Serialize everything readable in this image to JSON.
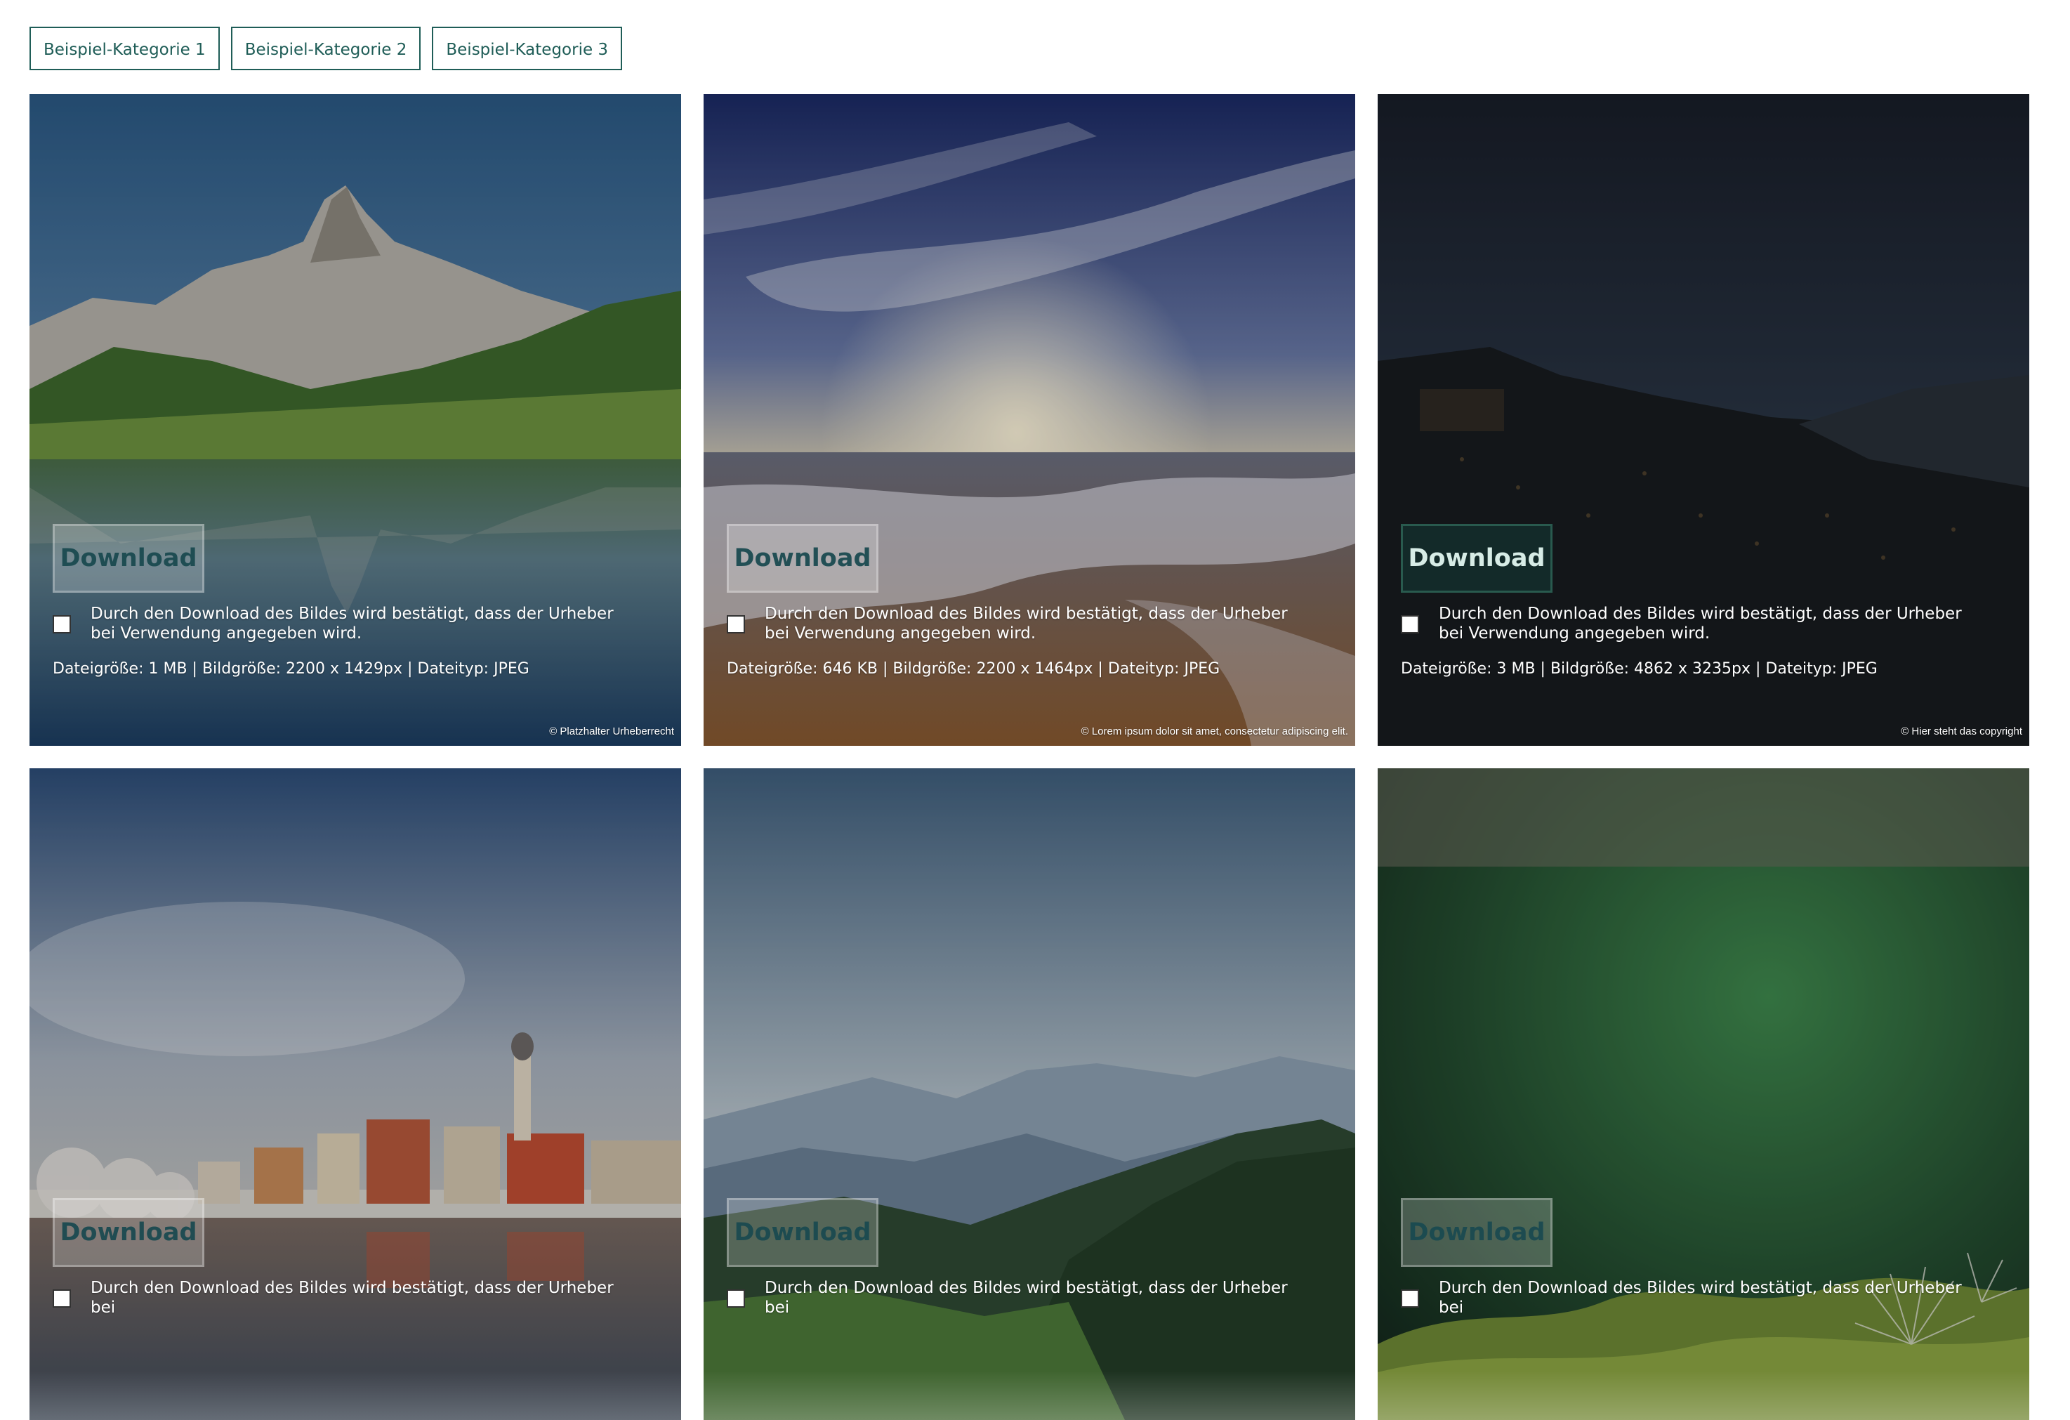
{
  "categories": [
    "Beispiel-Kategorie 1",
    "Beispiel-Kategorie 2",
    "Beispiel-Kategorie 3"
  ],
  "tiles": [
    {
      "scene": "mountain-lake",
      "download_label": "Download",
      "consent": "Durch den Download des Bildes wird bestätigt, dass der Urheber bei Verwendung angegeben wird.",
      "meta": "Dateigröße: 1 MB | Bildgröße: 2200 x 1429px | Dateityp: JPEG",
      "copyright": "© Platzhalter Urheberrecht"
    },
    {
      "scene": "beach-sunset",
      "download_label": "Download",
      "consent": "Durch den Download des Bildes wird bestätigt, dass der Urheber bei Verwendung angegeben wird.",
      "meta": "Dateigröße: 646 KB | Bildgröße: 2200 x 1464px | Dateityp: JPEG",
      "copyright": "© Lorem ipsum dolor sit amet, consectetur adipiscing elit."
    },
    {
      "scene": "night-city",
      "download_label": "Download",
      "consent": "Durch den Download des Bildes wird bestätigt, dass der Urheber bei Verwendung angegeben wird.",
      "meta": "Dateigröße: 3 MB | Bildgröße: 4862 x 3235px | Dateityp: JPEG",
      "copyright": "© Hier steht das copyright"
    },
    {
      "scene": "river-town",
      "download_label": "Download",
      "consent": "Durch den Download des Bildes wird bestätigt, dass der Urheber bei"
    },
    {
      "scene": "mountain-valley",
      "download_label": "Download",
      "consent": "Durch den Download des Bildes wird bestätigt, dass der Urheber bei"
    },
    {
      "scene": "moss-macro",
      "download_label": "Download",
      "consent": "Durch den Download des Bildes wird bestätigt, dass der Urheber bei"
    }
  ]
}
